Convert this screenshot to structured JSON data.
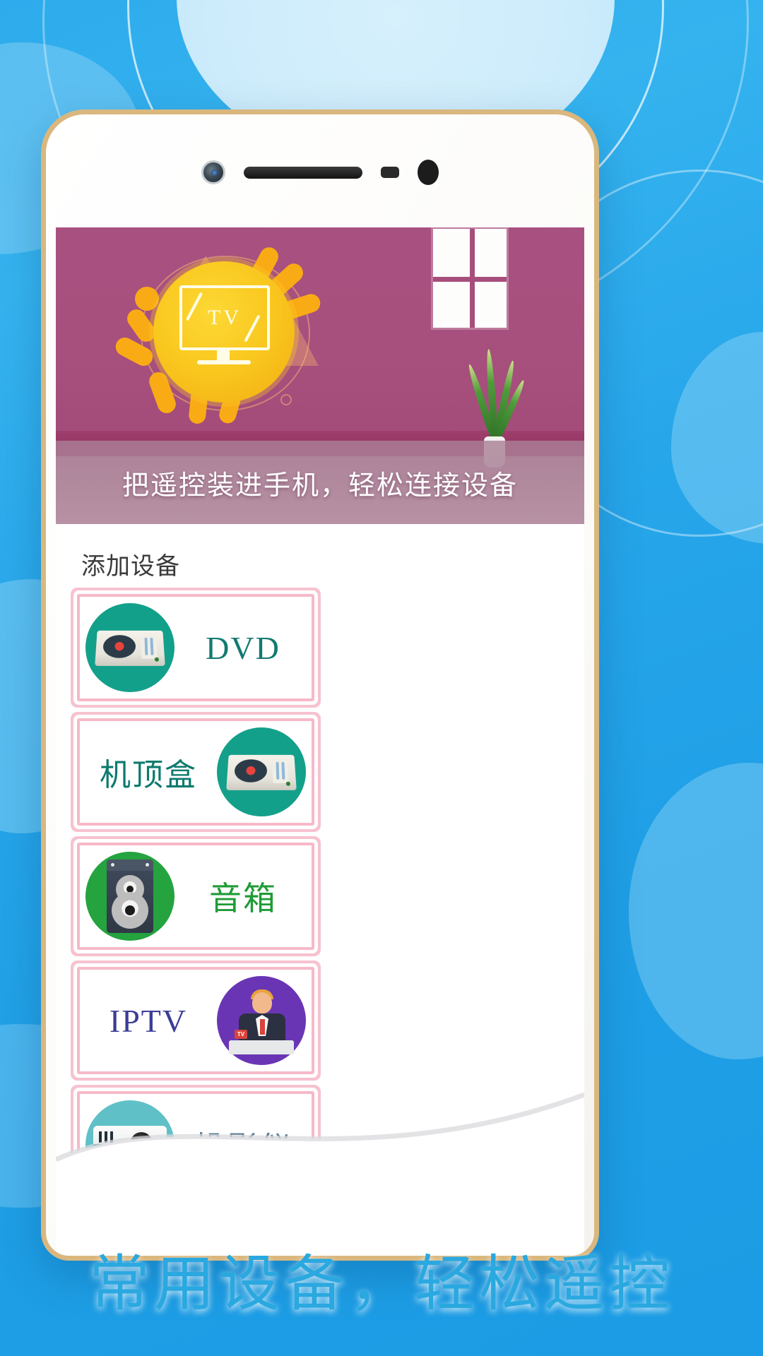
{
  "app": {
    "promo_headline": "常用设备，轻松遥控",
    "banner_caption": "把遥控装进手机，轻松连接设备",
    "hero_logo_text": "TV"
  },
  "section": {
    "add_device_title": "添加设备"
  },
  "devices": [
    {
      "label": "DVD",
      "icon": "dvd-player-icon",
      "icon_bg": "#13a08b",
      "text_color": "#117a72",
      "layout": "icon-left"
    },
    {
      "label": "机顶盒",
      "icon": "set-top-box-icon",
      "icon_bg": "#13a08b",
      "text_color": "#0e7a6e",
      "layout": "icon-right"
    },
    {
      "label": "音箱",
      "icon": "speaker-icon",
      "icon_bg": "#24a33f",
      "text_color": "#1f9b36",
      "layout": "icon-left"
    },
    {
      "label": "IPTV",
      "icon": "iptv-anchor-icon",
      "icon_bg": "#6a35b5",
      "text_color": "#3b3d96",
      "layout": "icon-right"
    },
    {
      "label": "投影仪",
      "icon": "projector-icon",
      "icon_bg": "#5fc0c8",
      "text_color": "#5f7f96",
      "layout": "icon-left"
    }
  ],
  "colors": {
    "background_blue": "#27a6ea",
    "hero_magenta": "#a84e7c",
    "card_border_pink": "#f6b9c8",
    "headline_blue": "#2aa8e0",
    "phone_frame_gold": "#d9b77e"
  },
  "phone_hardware": {
    "camera": "front-camera",
    "earpiece": "earpiece-speaker",
    "proximity": "proximity-sensor",
    "light_sensor": "light-sensor"
  }
}
